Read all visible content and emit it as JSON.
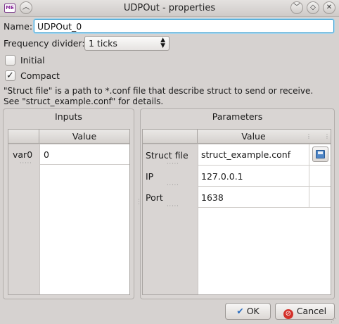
{
  "window": {
    "title": "UDPOut - properties",
    "app_icon_text": "ME"
  },
  "form": {
    "name_label": "Name:",
    "name_value": "UDPOut_0",
    "freq_label": "Frequency divider:",
    "freq_value": "1 ticks",
    "initial_label": "Initial",
    "initial_checked": false,
    "compact_label": "Compact",
    "compact_checked": true,
    "help_line1": "\"Struct file\" is a path to *.conf file that describe struct to send or receive.",
    "help_line2": "See \"struct_example.conf\" for details."
  },
  "inputs": {
    "title": "Inputs",
    "column_header": "Value",
    "rows": [
      {
        "name": "var0",
        "value": "0"
      }
    ]
  },
  "parameters": {
    "title": "Parameters",
    "column_header": "Value",
    "rows": [
      {
        "name": "Struct file",
        "value": "struct_example.conf",
        "has_browse": true
      },
      {
        "name": "IP",
        "value": "127.0.0.1"
      },
      {
        "name": "Port",
        "value": "1638"
      }
    ]
  },
  "buttons": {
    "ok_label": "OK",
    "cancel_label": "Cancel"
  }
}
